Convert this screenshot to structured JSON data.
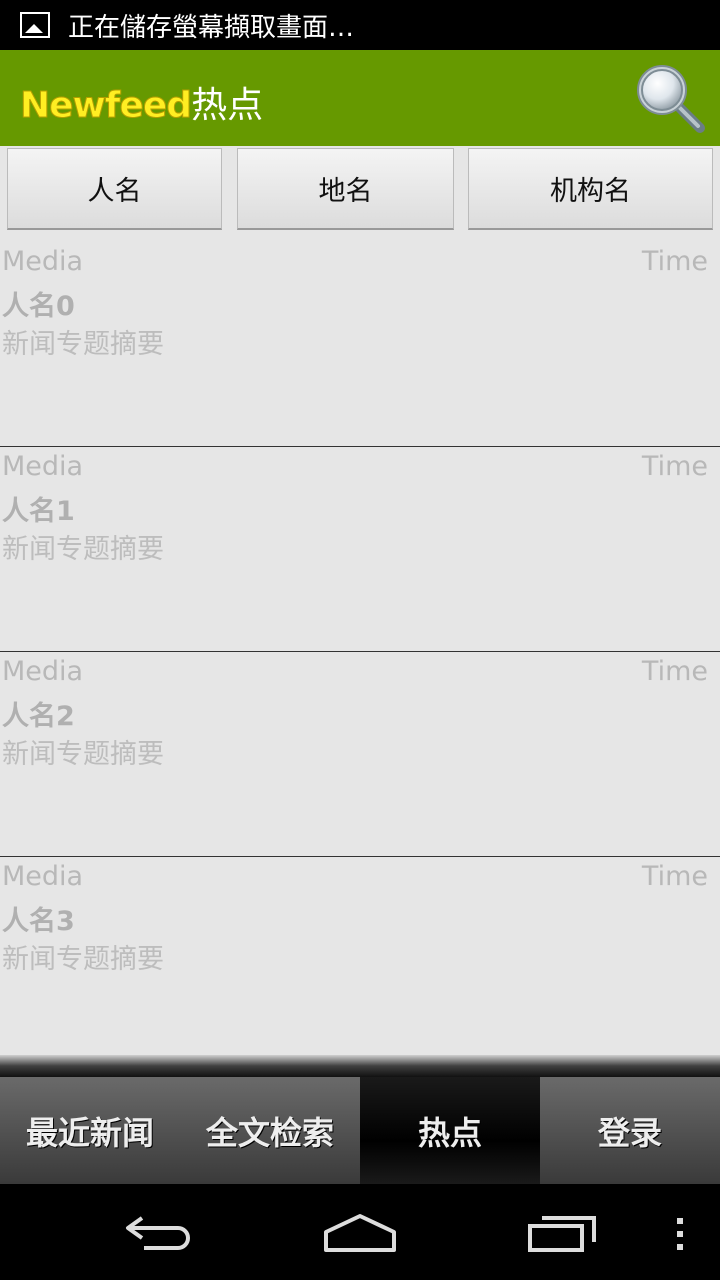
{
  "status_bar": {
    "text": "正在儲存螢幕擷取畫面…"
  },
  "header": {
    "logo_text": "Newfeed",
    "title": "热点",
    "search_icon": "magnifier-icon"
  },
  "category_tabs": [
    {
      "label": "人名"
    },
    {
      "label": "地名"
    },
    {
      "label": "机构名"
    }
  ],
  "news_list": [
    {
      "media": "Media",
      "time": "Time",
      "name": "人名0",
      "summary": "新闻专题摘要"
    },
    {
      "media": "Media",
      "time": "Time",
      "name": "人名1",
      "summary": "新闻专题摘要"
    },
    {
      "media": "Media",
      "time": "Time",
      "name": "人名2",
      "summary": "新闻专题摘要"
    },
    {
      "media": "Media",
      "time": "Time",
      "name": "人名3",
      "summary": "新闻专题摘要"
    }
  ],
  "bottom_nav": [
    {
      "label": "最近新闻",
      "active": false
    },
    {
      "label": "全文检索",
      "active": false
    },
    {
      "label": "热点",
      "active": true
    },
    {
      "label": "登录",
      "active": false
    }
  ],
  "system_nav": {
    "back": "back-icon",
    "home": "home-icon",
    "recents": "recents-icon",
    "menu": "menu-icon"
  },
  "colors": {
    "header_bg": "#669900",
    "logo_yellow": "#ffee22",
    "list_bg": "#e6e6e6"
  }
}
